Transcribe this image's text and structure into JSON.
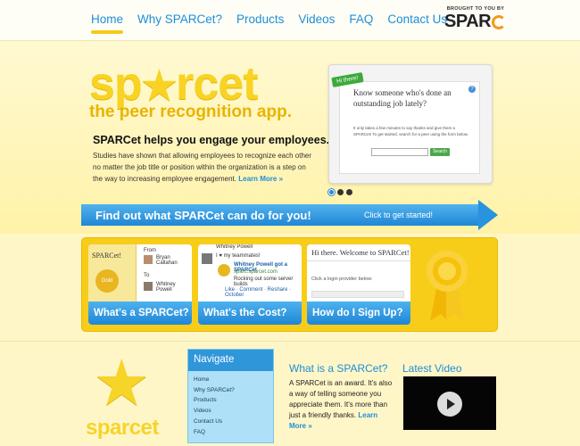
{
  "nav": {
    "items": [
      "Home",
      "Why SPARCet?",
      "Products",
      "Videos",
      "FAQ",
      "Contact Us"
    ],
    "active": "Home"
  },
  "brand": {
    "tag": "BROUGHT TO YOU BY",
    "name": "SPAR"
  },
  "hero": {
    "logo": "sp rcet",
    "logo_first": "sp",
    "logo_rest": "rcet",
    "tagline": "the peer recognition app.",
    "title": "SPARCet helps you engage your employees.",
    "text": "Studies have shown that allowing employees to recognize each other no matter the job title or position within the organization is a step on the way to increasing employee engagement.",
    "learn_more": "Learn More »"
  },
  "screenshot": {
    "badge": "Hi there!",
    "question": "Know someone who's done an outstanding job lately?",
    "small_text": "It only takes a few minutes to say thanks and give them a SPARCet! To get started, search for a peer using the form below.",
    "button": "Search",
    "help": "?"
  },
  "slider": {
    "total": 3,
    "active": 0
  },
  "banner": {
    "text": "Find out what SPARCet can do for you!",
    "cta": "Click to get started!"
  },
  "cards": [
    {
      "label": "What's a SPARCet?",
      "img_title": "SPARCet!",
      "img_sub": "Gold",
      "from": "From",
      "to": "To",
      "person1": "Bryan Callahan",
      "person2": "Whitney Powell"
    },
    {
      "label": "What's the Cost?",
      "post_name": "Whitney Powell",
      "post_text": "I ♥ my teammates!",
      "post_title": "Whitney Powell got a SPARCet",
      "post_site": "sparc.sparcet.com",
      "post_sub": "Rocking out some server builds",
      "post_actions": "Like · Comment · Reshare · October"
    },
    {
      "label": "How do I Sign Up?",
      "welcome": "Hi there. Welcome to SPARCet!",
      "login": "Click a login provider below:"
    }
  ],
  "footer": {
    "logo": "sparcet",
    "navigate_title": "Navigate",
    "navigate_items": [
      "Home",
      "Why SPARCet?",
      "Products",
      "Videos",
      "Contact Us",
      "FAQ"
    ],
    "what_title": "What is a SPARCet?",
    "what_text": "A SPARCet is an award. It's also a way of telling someone you appreciate them. It's more than just a friendly thanks.",
    "what_more": "Learn More »",
    "video_title": "Latest Video"
  },
  "colors": {
    "accent": "#1d8ed8",
    "yellow": "#f8cd1a",
    "green": "#3daa3a"
  }
}
